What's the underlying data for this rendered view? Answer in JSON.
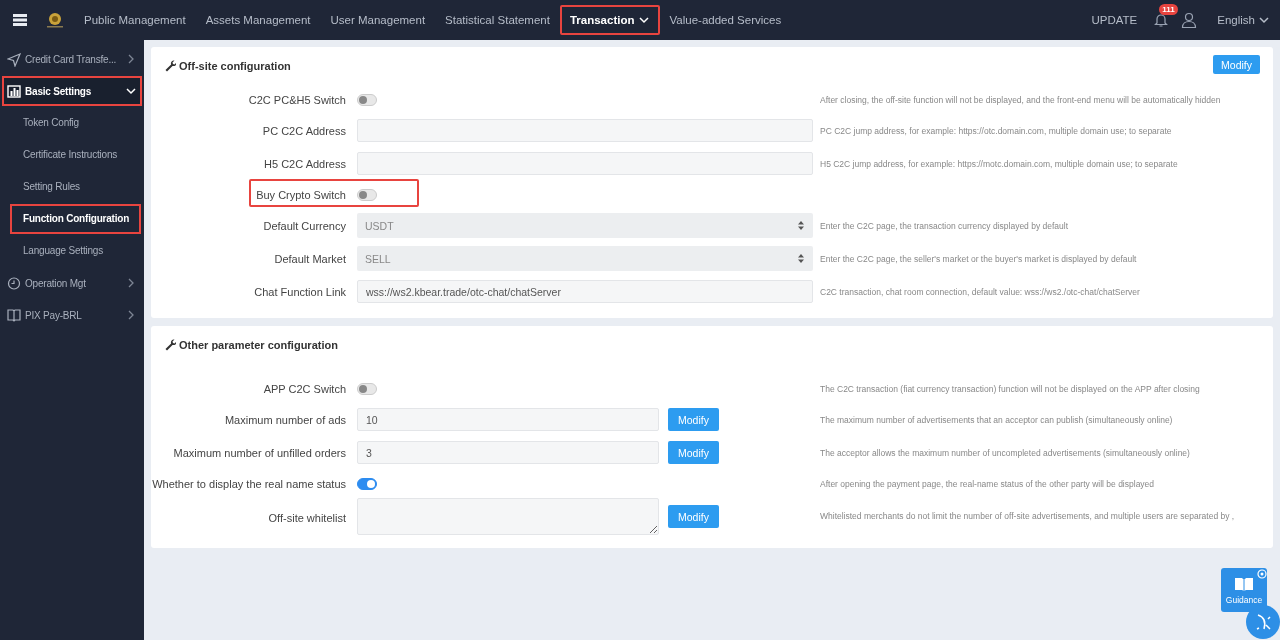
{
  "topbar": {
    "nav": [
      {
        "label": "Public Management",
        "selected": false,
        "highlighted": false
      },
      {
        "label": "Assets Management",
        "selected": false,
        "highlighted": false
      },
      {
        "label": "User Management",
        "selected": false,
        "highlighted": false
      },
      {
        "label": "Statistical Statement",
        "selected": false,
        "highlighted": false
      },
      {
        "label": "Transaction",
        "selected": true,
        "highlighted": true
      },
      {
        "label": "Value-added Services",
        "selected": false,
        "highlighted": false
      }
    ],
    "update": "UPDATE",
    "notification_count": "111",
    "language": "English"
  },
  "sidebar": {
    "items": [
      {
        "label": "Credit Card Transfe...",
        "expanded": false,
        "highlighted": false
      },
      {
        "label": "Basic Settings",
        "expanded": true,
        "highlighted": true,
        "children": [
          {
            "label": "Token Config",
            "selected": false,
            "highlighted": false
          },
          {
            "label": "Certificate Instructions",
            "selected": false,
            "highlighted": false
          },
          {
            "label": "Setting Rules",
            "selected": false,
            "highlighted": false
          },
          {
            "label": "Function Configuration",
            "selected": true,
            "highlighted": true
          },
          {
            "label": "Language Settings",
            "selected": false,
            "highlighted": false
          }
        ]
      },
      {
        "label": "Operation Mgt",
        "expanded": false,
        "highlighted": false
      },
      {
        "label": "PIX Pay-BRL",
        "expanded": false,
        "highlighted": false
      }
    ]
  },
  "sections": [
    {
      "title": "Off-site configuration",
      "button": "Modify",
      "rows": [
        {
          "kind": "switch",
          "label": "C2C PC&H5 Switch",
          "on": false,
          "highlighted": false,
          "help": "After closing, the off-site function will not be displayed, and the front-end menu will be automatically hidden"
        },
        {
          "kind": "input",
          "label": "PC C2C Address",
          "highlighted": false,
          "help": "PC C2C jump address, for example: https://otc.domain.com, multiple domain use; to separate"
        },
        {
          "kind": "input",
          "label": "H5 C2C Address",
          "highlighted": false,
          "help": "H5 C2C jump address, for example: https://motc.domain.com, multiple domain use; to separate"
        },
        {
          "kind": "switch",
          "label": "Buy Crypto Switch",
          "on": false,
          "highlighted": true
        },
        {
          "kind": "select",
          "label": "Default Currency",
          "value": "USDT",
          "highlighted": false,
          "help": "Enter the C2C page, the transaction currency displayed by default"
        },
        {
          "kind": "select",
          "label": "Default Market",
          "value": "SELL",
          "highlighted": false,
          "help": "Enter the C2C page, the seller's market or the buyer's market is displayed by default"
        },
        {
          "kind": "input",
          "label": "Chat Function Link",
          "value": "wss://ws2.kbear.trade/otc-chat/chatServer",
          "highlighted": false,
          "help": "C2C transaction, chat room connection, default value: wss://ws2./otc-chat/chatServer"
        }
      ]
    },
    {
      "title": "Other parameter configuration",
      "rows": [
        {
          "kind": "switch",
          "label": "APP C2C Switch",
          "on": false,
          "highlighted": false,
          "help": "The C2C transaction (fiat currency transaction) function will not be displayed on the APP after closing"
        },
        {
          "kind": "input",
          "label": "Maximum number of ads",
          "value": "10",
          "button": "Modify",
          "highlighted": false,
          "help": "The maximum number of advertisements that an acceptor can publish (simultaneously online)"
        },
        {
          "kind": "input",
          "label": "Maximum number of unfilled orders",
          "value": "3",
          "button": "Modify",
          "highlighted": false,
          "help": "The acceptor allows the maximum number of uncompleted advertisements (simultaneously online)"
        },
        {
          "kind": "switch",
          "label": "Whether to display the real name status",
          "on": true,
          "highlighted": false,
          "help": "After opening the payment page, the real-name status of the other party will be displayed"
        },
        {
          "kind": "textarea",
          "label": "Off-site whitelist",
          "button": "Modify",
          "highlighted": false,
          "help": "Whitelisted merchants do not limit the number of off-site advertisements, and multiple users are separated by ,"
        }
      ]
    }
  ],
  "guidance": {
    "label": "Guidance"
  }
}
